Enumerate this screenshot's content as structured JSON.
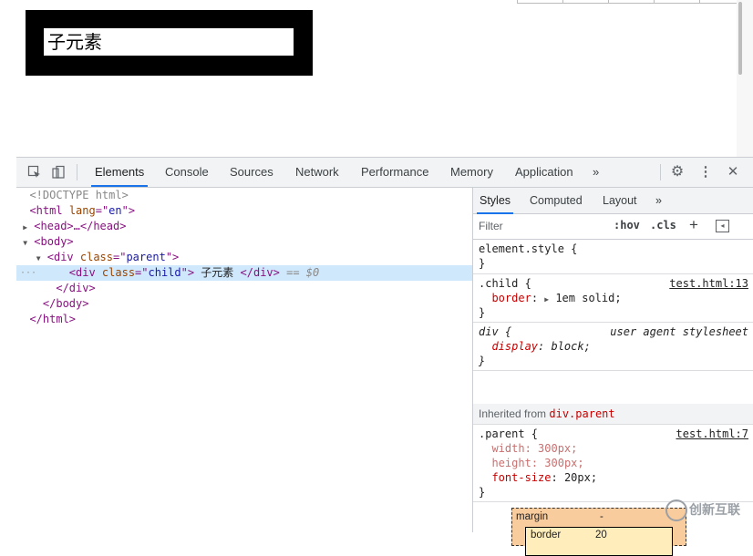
{
  "preview": {
    "child_text": "子元素"
  },
  "toolbar": {
    "tabs": [
      "Elements",
      "Console",
      "Sources",
      "Network",
      "Performance",
      "Memory",
      "Application"
    ],
    "more": "»"
  },
  "dom": {
    "doctype": "<!DOCTYPE html>",
    "html_open_tag": "<html ",
    "html_attr": "lang",
    "html_attr_eq": "=\"",
    "html_attr_val": "en",
    "html_attr_close": "\">",
    "head": "<head>…</head>",
    "body_open": "<body>",
    "div_parent_open": "<div ",
    "div_parent_attr": "class",
    "div_parent_attr_val": "parent",
    "div_child_open": "<div ",
    "div_child_attr": "class",
    "div_child_attr_val": "child",
    "div_child_text": " 子元素 ",
    "div_child_close": "</div>",
    "eq_marker": " == $0",
    "div_close": "</div>",
    "body_close": "</body>",
    "html_close": "</html>"
  },
  "styles_panel": {
    "tabs": [
      "Styles",
      "Computed",
      "Layout"
    ],
    "more": "»",
    "filter_placeholder": "Filter",
    "hov": ":hov",
    "cls": ".cls",
    "plus": "+",
    "element_style": "element.style {",
    "brace_close": "}",
    "child_selector": ".child {",
    "child_link": "test.html:13",
    "child_prop": "border",
    "child_val": "1em solid;",
    "div_selector": "div {",
    "div_ua": "user agent stylesheet",
    "div_prop": "display",
    "div_val": "block;",
    "inherited_label": "Inherited from ",
    "inherited_selector": "div.parent",
    "parent_selector": ".parent {",
    "parent_link": "test.html:7",
    "parent_width_prop": "width",
    "parent_width_val": "300px;",
    "parent_height_prop": "height",
    "parent_height_val": "300px;",
    "parent_font_prop": "font-size",
    "parent_font_val": "20px;"
  },
  "box_model": {
    "margin_label": "margin",
    "margin_value": "-",
    "border_label": "border",
    "border_value": "20"
  },
  "watermark": "创新互联"
}
